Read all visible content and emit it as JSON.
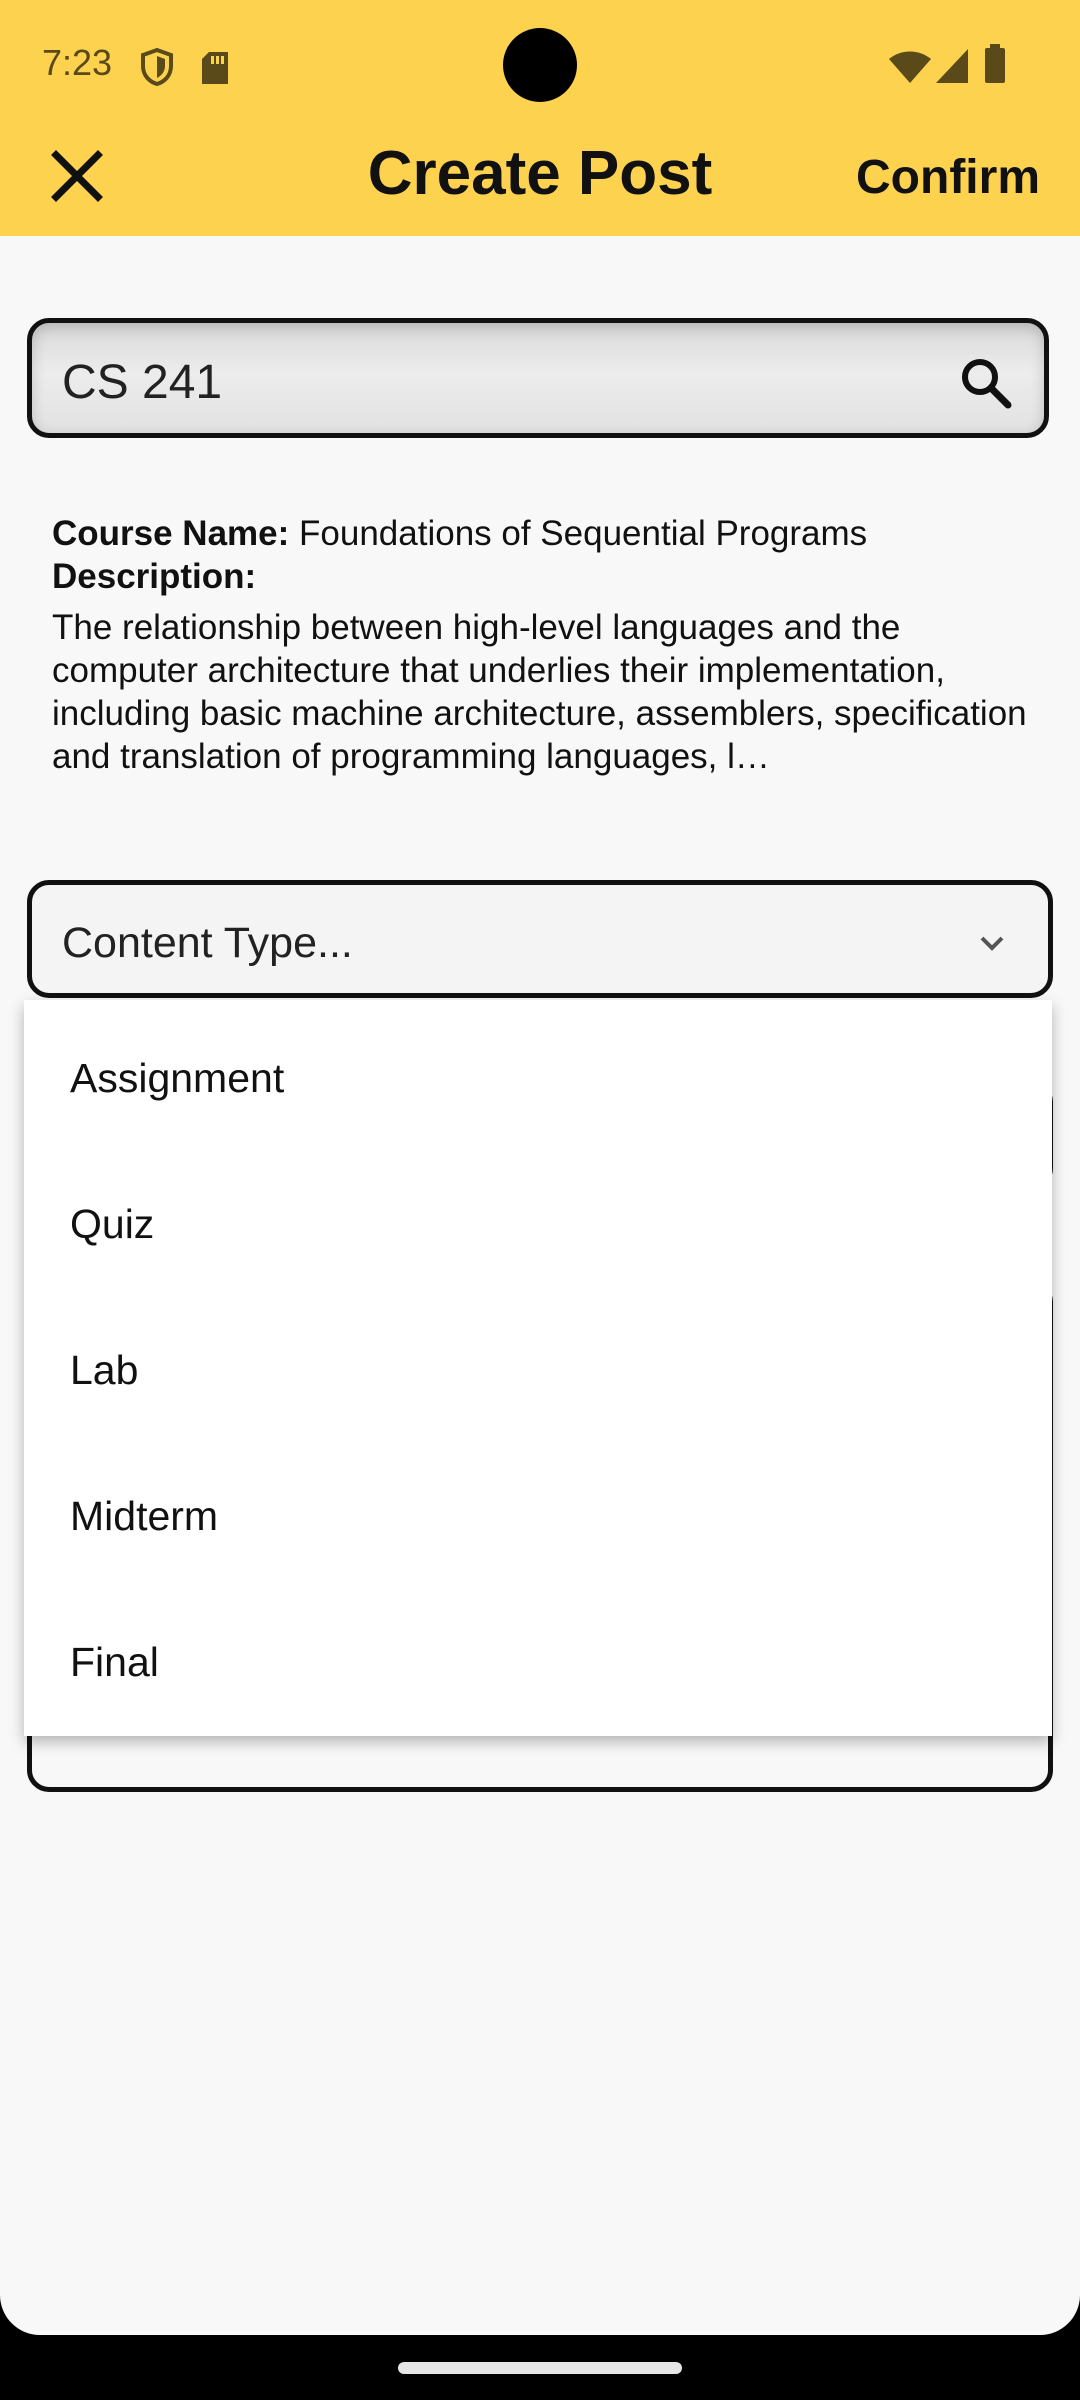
{
  "status_bar": {
    "time": "7:23",
    "icons": [
      "shield-icon",
      "sd-card-icon",
      "wifi-icon",
      "signal-icon",
      "battery-icon"
    ]
  },
  "header": {
    "title": "Create Post",
    "confirm_label": "Confirm",
    "close_icon": "close-icon",
    "color": "#fdd24f"
  },
  "search": {
    "value": "CS 241",
    "icon": "search-icon"
  },
  "course": {
    "name_label": "Course Name:",
    "name_value": "Foundations of Sequential Programs",
    "description_label": "Description:",
    "description": "The relationship between high-level languages and the computer architecture that underlies their implementation, including basic machine architecture, assemblers, specification and translation of programming languages, l…"
  },
  "content_type": {
    "placeholder": "Content Type...",
    "icon": "chevron-down-icon",
    "options": [
      "Assignment",
      "Quiz",
      "Lab",
      "Midterm",
      "Final"
    ]
  }
}
